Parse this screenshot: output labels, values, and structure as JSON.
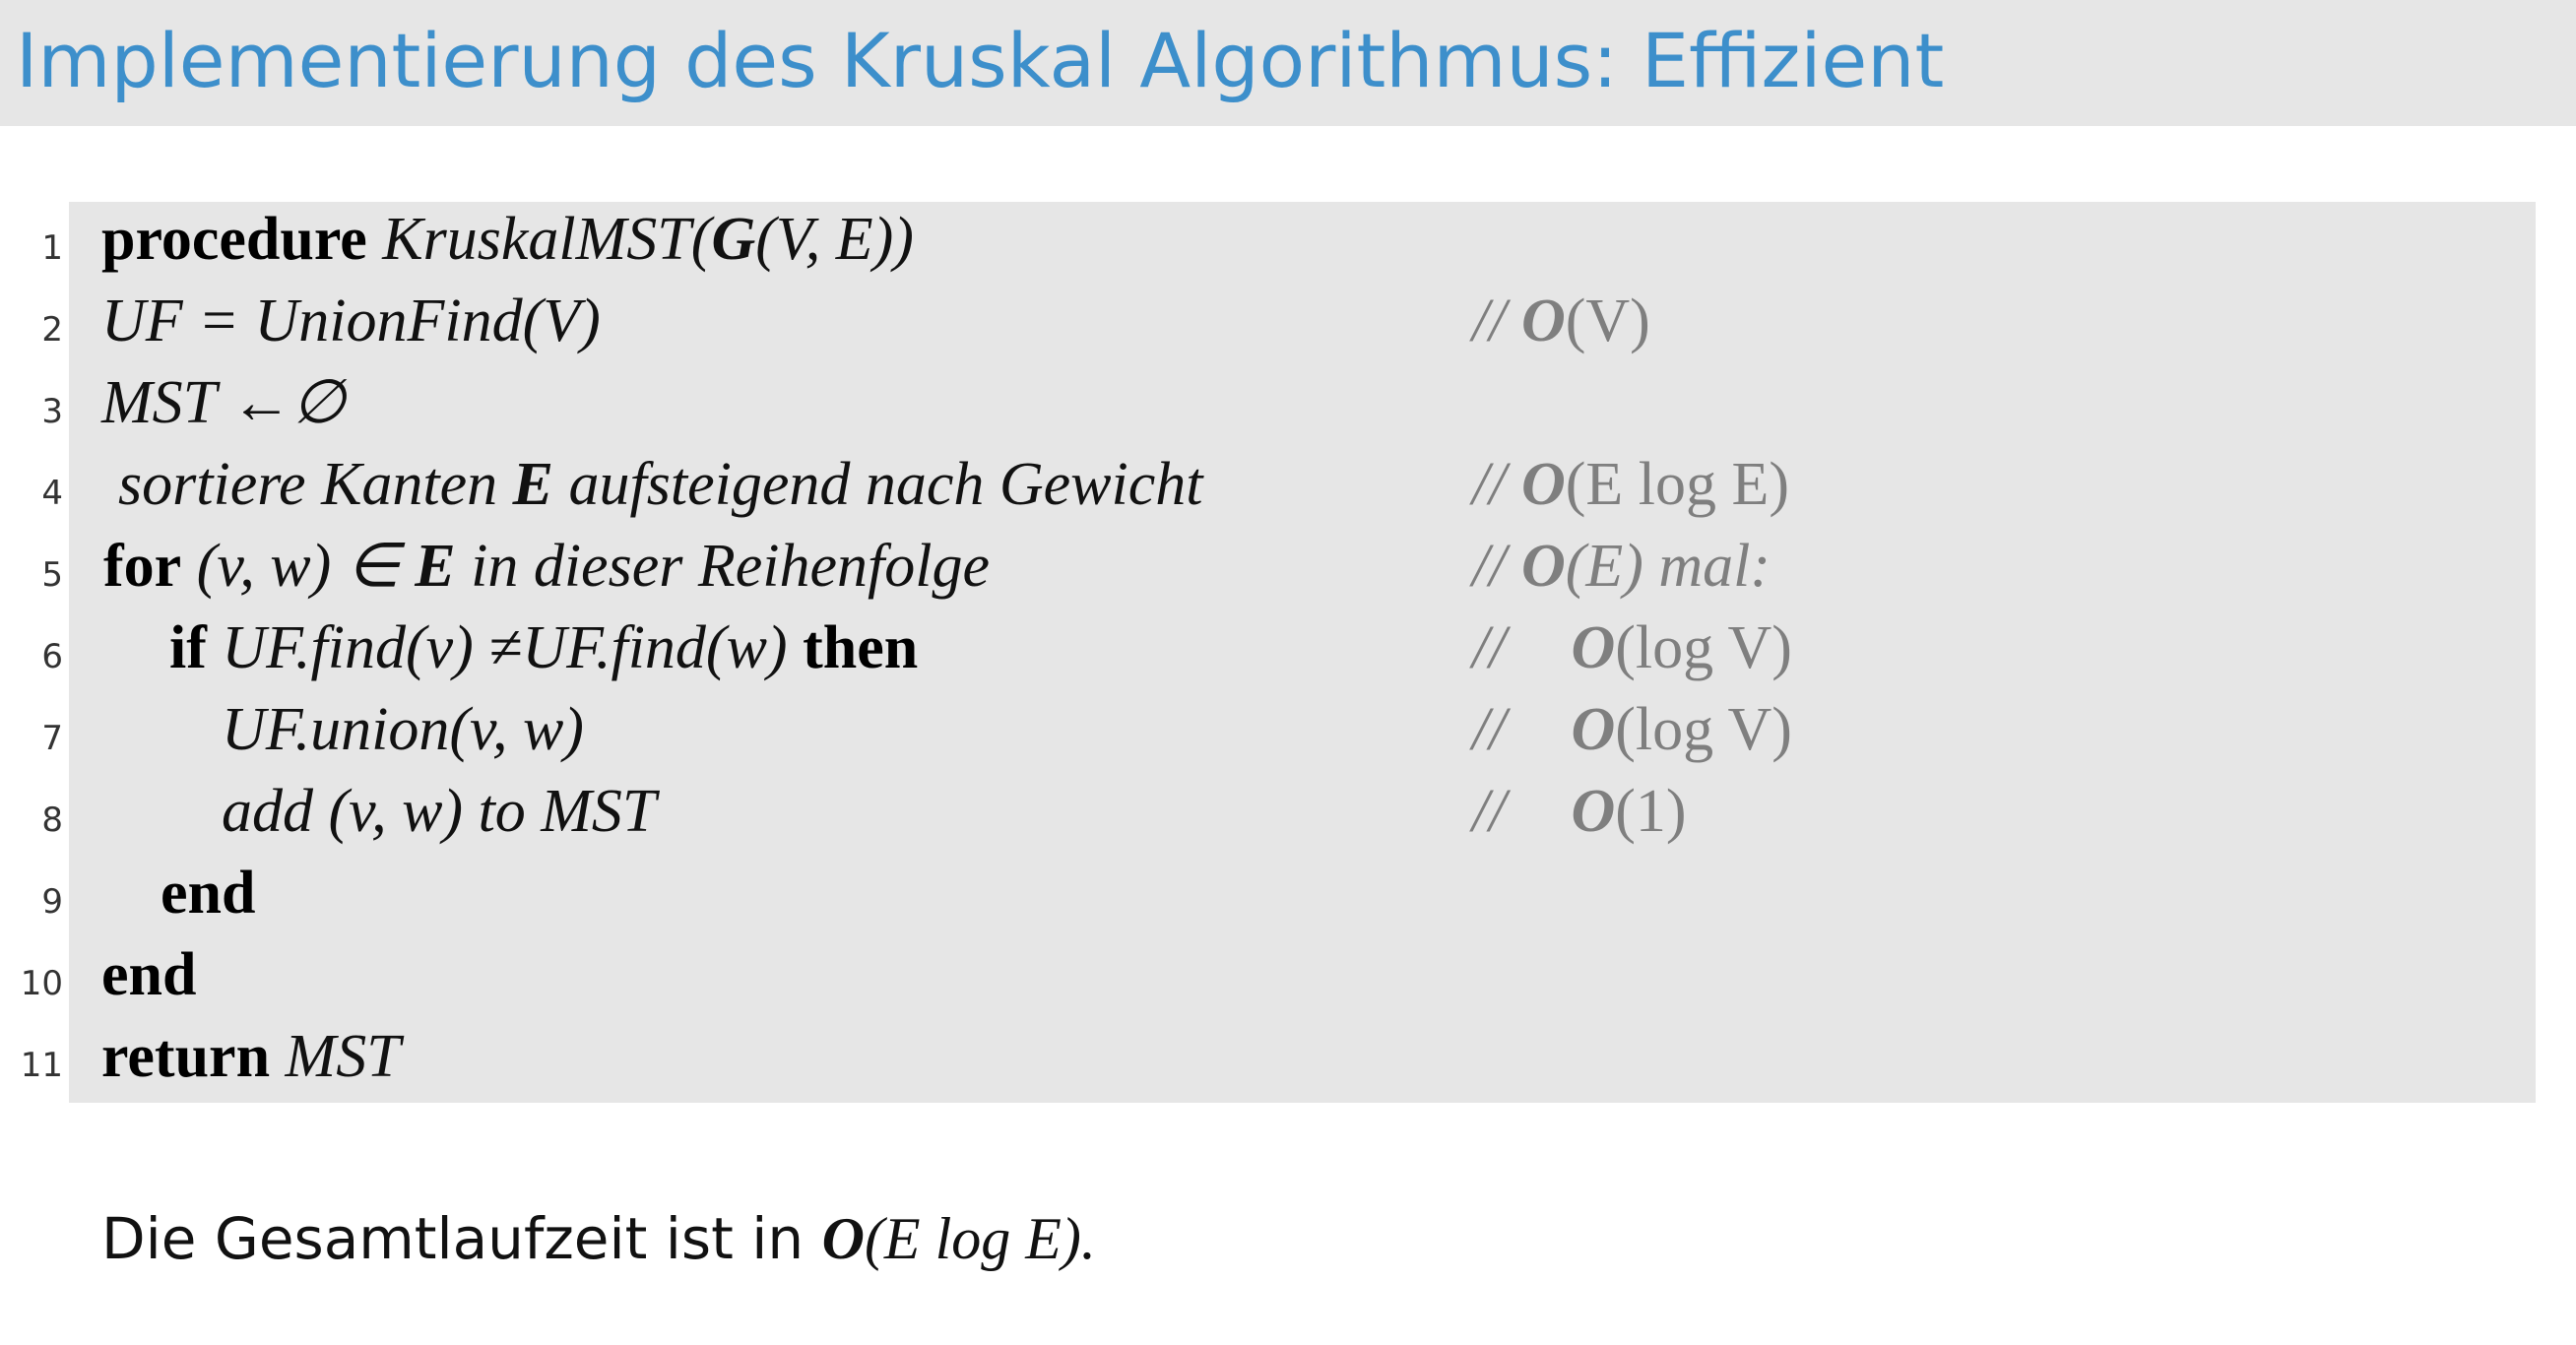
{
  "slide": {
    "title": "Implementierung des Kruskal Algorithmus: Effizient",
    "colors": {
      "title": "#3d8fcb",
      "title_bar_bg": "#e6e6e6",
      "code_bg": "#e6e6e6",
      "comment": "#7f7f7f"
    }
  },
  "code": {
    "lines": [
      {
        "num": "1",
        "kw1": "procedure",
        "t1": "KruskalMST(",
        "t2": "G",
        "t3": "(V, E))"
      },
      {
        "num": "2",
        "t1": "UF = UnionFind(V)",
        "c_slash": "//",
        "c_big": "O",
        "c_rest": "(V)"
      },
      {
        "num": "3",
        "t1": "MST ←∅"
      },
      {
        "num": "4",
        "t1": "sortiere   Kanten ",
        "t2": "E",
        "t3": " aufsteigend nach Gewicht",
        "c_slash": "//",
        "c_big": "O",
        "c_rest": "(E log E)"
      },
      {
        "num": "5",
        "kw1": "for",
        "t1": " (v, w) ∈ ",
        "t2": "E",
        "t3": " in dieser Reihenfolge",
        "c_slash": "//",
        "c_big": "O",
        "c_rest": "(E) mal:"
      },
      {
        "num": "6",
        "kw1": "if",
        "t1": " UF.find(v) ≠UF.find(w) ",
        "kw2": "then",
        "c_slash": "//",
        "c_big": "O",
        "c_rest": "(log V)"
      },
      {
        "num": "7",
        "t1": "UF.union(v, w)",
        "c_slash": "//",
        "c_big": "O",
        "c_rest": "(log V)"
      },
      {
        "num": "8",
        "t1": "add (v, w) to MST",
        "c_slash": "//",
        "c_big": "O",
        "c_rest": "(1)"
      },
      {
        "num": "9",
        "kw1": "end"
      },
      {
        "num": "10",
        "kw1": "end"
      },
      {
        "num": "11",
        "kw1": "return",
        "t1": " MST"
      }
    ]
  },
  "summary": {
    "text": "Die Gesamtlaufzeit ist in ",
    "big_o": "O",
    "rest": "(E log E)."
  }
}
